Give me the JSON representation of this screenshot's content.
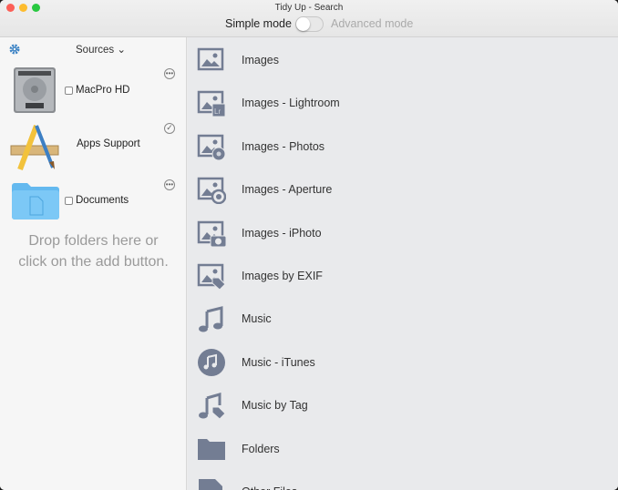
{
  "window": {
    "title": "Tidy Up - Search",
    "simple_mode_label": "Simple mode",
    "advanced_mode_label": "Advanced mode",
    "mode_toggle_advanced": false
  },
  "sidebar": {
    "header": "Sources ⌄",
    "sources": [
      {
        "label": "MacPro HD",
        "icon": "hard-drive-icon",
        "checked": false,
        "action": "more-icon"
      },
      {
        "label": "Apps Support",
        "icon": "applications-icon",
        "action": "checkmark-icon"
      },
      {
        "label": "Documents",
        "icon": "folder-icon",
        "checked": false,
        "action": "more-icon"
      }
    ],
    "drop_hint_line1": "Drop folders here or",
    "drop_hint_line2": "click on the add button."
  },
  "search_types": [
    {
      "label": "Images",
      "icon": "image-icon"
    },
    {
      "label": "Images - Lightroom",
      "icon": "image-lightroom-icon"
    },
    {
      "label": "Images - Photos",
      "icon": "image-photos-icon"
    },
    {
      "label": "Images - Aperture",
      "icon": "image-aperture-icon"
    },
    {
      "label": "Images - iPhoto",
      "icon": "image-iphoto-icon"
    },
    {
      "label": "Images by EXIF",
      "icon": "image-tag-icon"
    },
    {
      "label": "Music",
      "icon": "music-note-icon"
    },
    {
      "label": "Music - iTunes",
      "icon": "itunes-icon"
    },
    {
      "label": "Music by Tag",
      "icon": "music-tag-icon"
    },
    {
      "label": "Folders",
      "icon": "folder-icon"
    },
    {
      "label": "Other Files",
      "icon": "file-icon"
    }
  ],
  "colors": {
    "icon": "#737d93",
    "accent": "#3b82c4"
  }
}
